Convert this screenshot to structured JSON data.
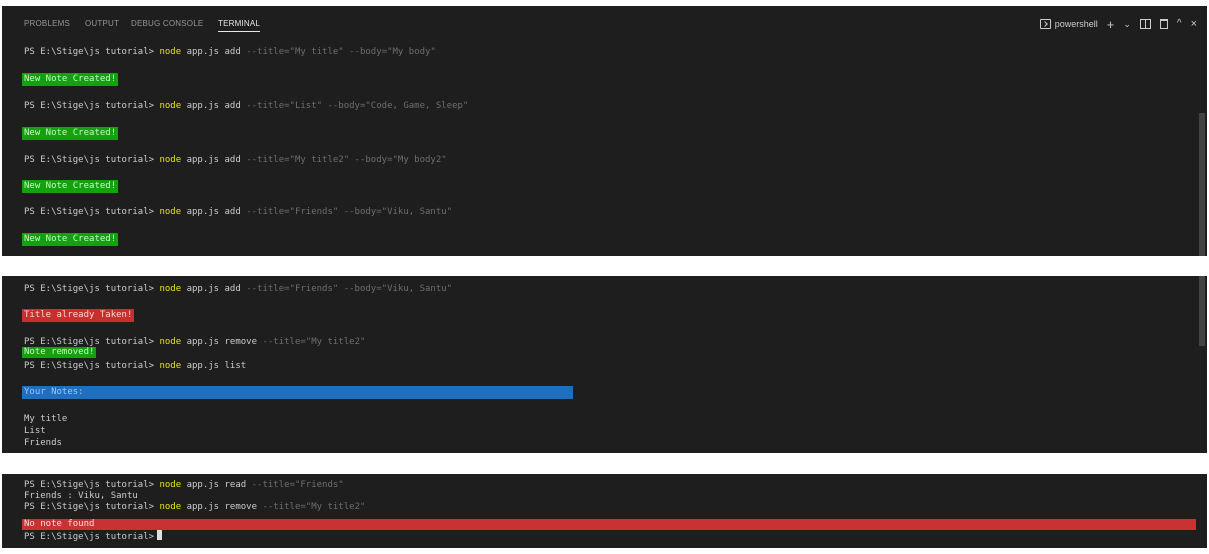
{
  "panel_tabs": [
    "PROBLEMS",
    "OUTPUT",
    "DEBUG CONSOLE",
    "TERMINAL"
  ],
  "active_tab": "TERMINAL",
  "shell_label": "powershell",
  "icons": {
    "new_terminal": "plus-icon",
    "dropdown": "chevron-down-icon",
    "split": "split-terminal-icon",
    "kill": "trash-icon",
    "maximize": "chevron-up-icon",
    "close": "close-icon"
  },
  "prompt": "PS E:\\Stige\\js tutorial>",
  "panel1": {
    "lines": [
      {
        "cmd": "node",
        "args": "app.js add",
        "opts": "--title=\"My title\" --body=\"My body\""
      },
      {
        "msg": "New Note Created!"
      },
      {
        "cmd": "node",
        "args": "app.js add",
        "opts": "--title=\"List\" --body=\"Code, Game, Sleep\""
      },
      {
        "msg": "New Note Created!"
      },
      {
        "cmd": "node",
        "args": "app.js add",
        "opts": "--title=\"My title2\" --body=\"My body2\""
      },
      {
        "msg": "New Note Created!"
      },
      {
        "cmd": "node",
        "args": "app.js add",
        "opts": "--title=\"Friends\" --body=\"Viku, Santu\""
      },
      {
        "msg": "New Note Created!"
      }
    ]
  },
  "panel2": {
    "cmd1": {
      "cmd": "node",
      "args": "app.js add",
      "opts": "--title=\"Friends\" --body=\"Viku, Santu\""
    },
    "err1": "Title already Taken!",
    "cmd2": {
      "cmd": "node",
      "args": "app.js remove",
      "opts": "--title=\"My title2\""
    },
    "ok2": "Note removed!",
    "cmd3": {
      "cmd": "node",
      "args": "app.js list",
      "opts": ""
    },
    "list_header": "Your Notes:",
    "notes": [
      "My title",
      "List",
      "Friends"
    ]
  },
  "panel3": {
    "cmd1": {
      "cmd": "node",
      "args": "app.js read",
      "opts": "--title=\"Friends\""
    },
    "out1": "Friends : Viku, Santu",
    "cmd2": {
      "cmd": "node",
      "args": "app.js remove",
      "opts": "--title=\"My title2\""
    },
    "err2": "No note found"
  },
  "colors": {
    "background": "#1e1e1e",
    "command_yellow": "#e5e510",
    "success_green": "#13a10e",
    "error_red": "#c72e2e",
    "info_blue": "#1f6fc0"
  }
}
